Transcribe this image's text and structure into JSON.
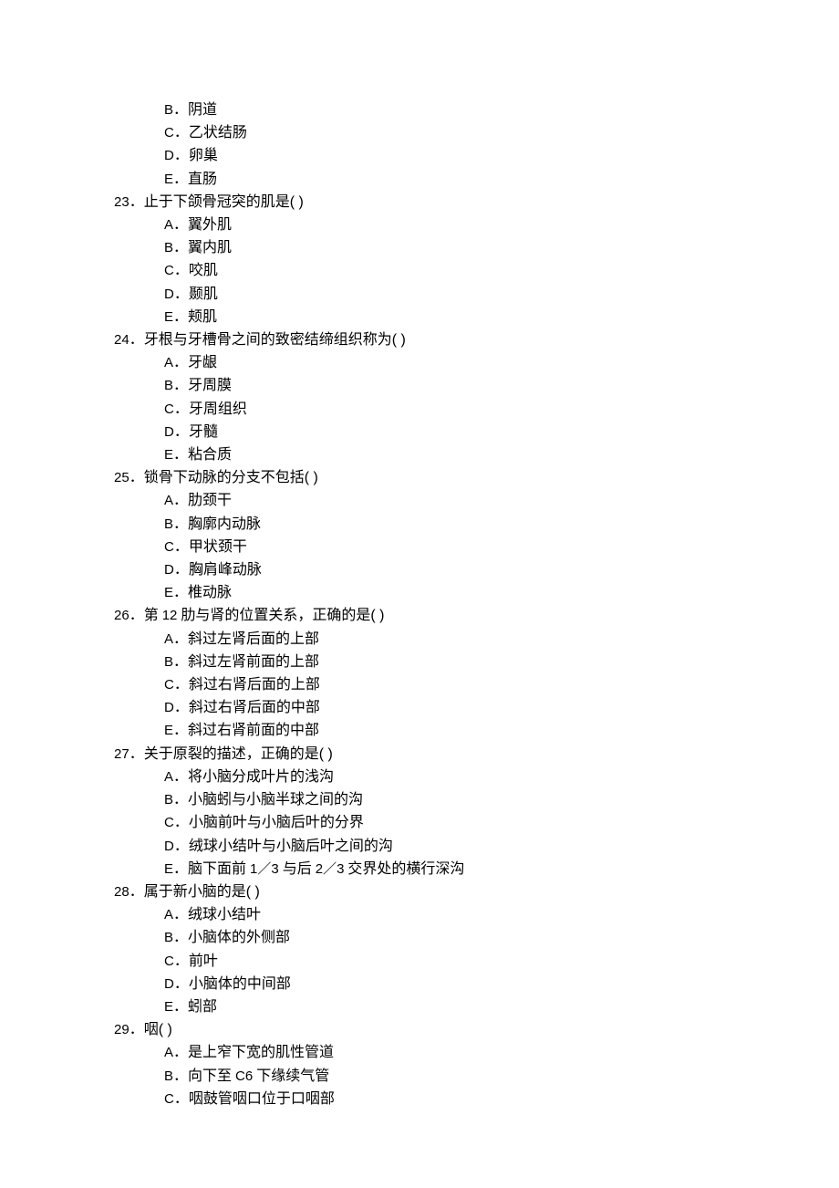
{
  "lines": [
    {
      "type": "option",
      "letter": "B",
      "text": "阴道"
    },
    {
      "type": "option",
      "letter": "C",
      "text": "乙状结肠"
    },
    {
      "type": "option",
      "letter": "D",
      "text": "卵巢"
    },
    {
      "type": "option",
      "letter": "E",
      "text": "直肠"
    },
    {
      "type": "question",
      "num": "23",
      "text": "止于下颌骨冠突的肌是",
      "paren": true
    },
    {
      "type": "option",
      "letter": "A",
      "text": "翼外肌"
    },
    {
      "type": "option",
      "letter": "B",
      "text": "翼内肌"
    },
    {
      "type": "option",
      "letter": "C",
      "text": "咬肌"
    },
    {
      "type": "option",
      "letter": "D",
      "text": "颞肌"
    },
    {
      "type": "option",
      "letter": "E",
      "text": "颊肌"
    },
    {
      "type": "question",
      "num": "24",
      "text": "牙根与牙槽骨之间的致密结缔组织称为",
      "paren": true
    },
    {
      "type": "option",
      "letter": "A",
      "text": "牙龈"
    },
    {
      "type": "option",
      "letter": "B",
      "text": "牙周膜"
    },
    {
      "type": "option",
      "letter": "C",
      "text": "牙周组织"
    },
    {
      "type": "option",
      "letter": "D",
      "text": "牙髓"
    },
    {
      "type": "option",
      "letter": "E",
      "text": "粘合质"
    },
    {
      "type": "question",
      "num": "25",
      "text": "锁骨下动脉的分支不包括",
      "paren": true
    },
    {
      "type": "option",
      "letter": "A",
      "text": "肋颈干"
    },
    {
      "type": "option",
      "letter": "B",
      "text": "胸廓内动脉"
    },
    {
      "type": "option",
      "letter": "C",
      "text": "甲状颈干"
    },
    {
      "type": "option",
      "letter": "D",
      "text": "胸肩峰动脉"
    },
    {
      "type": "option",
      "letter": "E",
      "text": "椎动脉"
    },
    {
      "type": "question",
      "num": "26",
      "text_pre": "第 ",
      "roman": "12",
      "text_post": " 肋与肾的位置关系，正确的是",
      "paren": true
    },
    {
      "type": "option",
      "letter": "A",
      "text": "斜过左肾后面的上部"
    },
    {
      "type": "option",
      "letter": "B",
      "text": "斜过左肾前面的上部"
    },
    {
      "type": "option",
      "letter": "C",
      "text": "斜过右肾后面的上部"
    },
    {
      "type": "option",
      "letter": "D",
      "text": "斜过右肾后面的中部"
    },
    {
      "type": "option",
      "letter": "E",
      "text": "斜过右肾前面的中部"
    },
    {
      "type": "question",
      "num": "27",
      "text": "关于原裂的描述，正确的是",
      "paren": true
    },
    {
      "type": "option",
      "letter": "A",
      "text": "将小脑分成叶片的浅沟"
    },
    {
      "type": "option",
      "letter": "B",
      "text": "小脑蚓与小脑半球之间的沟"
    },
    {
      "type": "option",
      "letter": "C",
      "text": "小脑前叶与小脑后叶的分界"
    },
    {
      "type": "option",
      "letter": "D",
      "text": "绒球小结叶与小脑后叶之间的沟"
    },
    {
      "type": "option_frac",
      "letter": "E",
      "text_pre": "脑下面前 ",
      "f1": "1／3",
      "mid": " 与后 ",
      "f2": "2／3",
      "text_post": " 交界处的横行深沟"
    },
    {
      "type": "question",
      "num": "28",
      "text": "属于新小脑的是",
      "paren": true
    },
    {
      "type": "option",
      "letter": "A",
      "text": "绒球小结叶"
    },
    {
      "type": "option",
      "letter": "B",
      "text": "小脑体的外侧部"
    },
    {
      "type": "option",
      "letter": "C",
      "text": "前叶"
    },
    {
      "type": "option",
      "letter": "D",
      "text": "小脑体的中间部"
    },
    {
      "type": "option",
      "letter": "E",
      "text": "蚓部"
    },
    {
      "type": "question",
      "num": "29",
      "text": "咽",
      "paren": true
    },
    {
      "type": "option",
      "letter": "A",
      "text": "是上窄下宽的肌性管道"
    },
    {
      "type": "option_c6",
      "letter": "B",
      "text_pre": "向下至 ",
      "c6": "C6",
      "text_post": " 下缘续气管"
    },
    {
      "type": "option",
      "letter": "C",
      "text": "咽鼓管咽口位于口咽部"
    }
  ]
}
